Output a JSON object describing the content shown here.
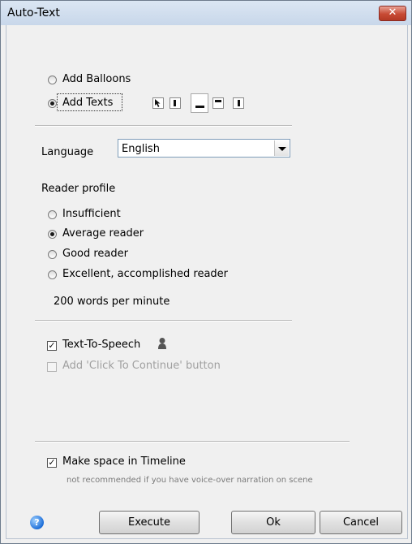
{
  "window": {
    "title": "Auto-Text",
    "close_label": "✕"
  },
  "mode": {
    "add_balloons_label": "Add Balloons",
    "add_texts_label": "Add Texts",
    "selected": "Add Texts"
  },
  "language": {
    "label": "Language",
    "value": "English"
  },
  "reader_profile": {
    "heading": "Reader profile",
    "options": [
      "Insufficient",
      "Average reader",
      "Good reader",
      "Excellent, accomplished reader"
    ],
    "selected": "Average reader",
    "speed_text": "200 words per minute"
  },
  "options": {
    "text_to_speech_label": "Text-To-Speech",
    "text_to_speech_checked": true,
    "click_to_continue_label": "Add 'Click To Continue' button",
    "click_to_continue_checked": false,
    "click_to_continue_enabled": false
  },
  "timeline": {
    "make_space_label": "Make space in Timeline",
    "make_space_checked": true,
    "note": "not recommended if you have voice-over narration on scene"
  },
  "buttons": {
    "execute": "Execute",
    "ok": "Ok",
    "cancel": "Cancel",
    "help_glyph": "?"
  },
  "icons": {
    "close": "close-icon",
    "help": "help-icon",
    "speaker": "speaker-profile-icon",
    "positions": [
      "cursor-position-icon",
      "left-position-icon",
      "bottom-position-icon",
      "top-position-icon",
      "right-position-icon"
    ]
  }
}
